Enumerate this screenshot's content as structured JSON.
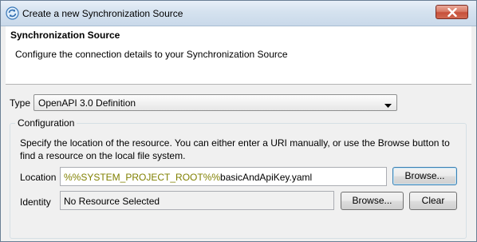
{
  "window": {
    "title": "Create a new Synchronization Source"
  },
  "banner": {
    "title": "Synchronization Source",
    "description": "Configure the connection details to your Synchronization Source"
  },
  "type": {
    "label": "Type",
    "selected": "OpenAPI 3.0 Definition"
  },
  "configuration": {
    "legend": "Configuration",
    "description": "Specify the location of the resource.  You can either enter a URI manually, or use the Browse button to find a resource on the local file system.",
    "location": {
      "label": "Location",
      "value_variable": "%%SYSTEM_PROJECT_ROOT%%",
      "value_path": "basicAndApiKey.yaml",
      "browse_label": "Browse..."
    },
    "identity": {
      "label": "Identity",
      "value": "No Resource Selected",
      "browse_label": "Browse...",
      "clear_label": "Clear"
    }
  },
  "colors": {
    "variable_text": "#808000",
    "close_button": "#c7503a"
  },
  "icons": {
    "app": "sync-icon",
    "close": "close-icon",
    "dropdown": "chevron-down-icon"
  }
}
